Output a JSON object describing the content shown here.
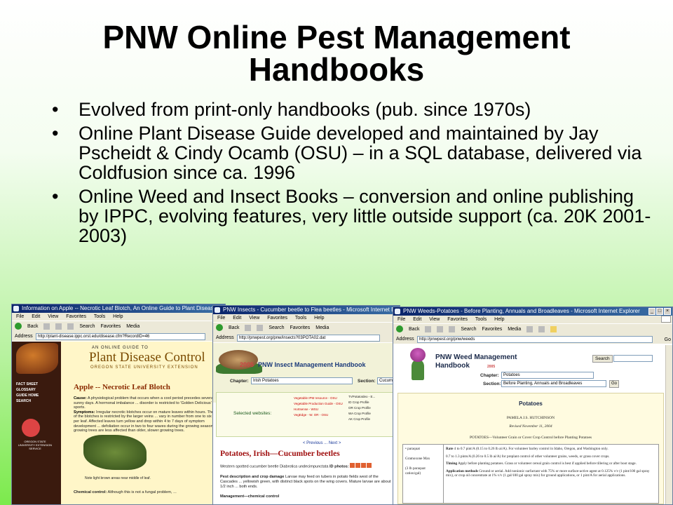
{
  "slide": {
    "title": "PNW Online Pest Management Handbooks",
    "bullets": [
      "Evolved from print-only handbooks (pub. since 1970s)",
      "Online Plant Disease Guide developed and maintained by Jay Pscheidt & Cindy Ocamb (OSU) – in a SQL database, delivered via Coldfusion since ca. 1996",
      "Online Weed and Insect Books – conversion and online publishing by IPPC, evolving features, very little outside support (ca. 20K 2001-2003)"
    ],
    "bullet_glyph": "•"
  },
  "browser": {
    "menu": [
      "File",
      "Edit",
      "View",
      "Favorites",
      "Tools",
      "Help"
    ],
    "back": "Back",
    "search": "Search",
    "favorites": "Favorites",
    "media": "Media",
    "address_label": "Address",
    "go": "Go"
  },
  "window1": {
    "title": "Information on Apple -- Necrotic Leaf Blotch, An Online Guide to Plant Disease Control",
    "url": "http://plant-disease.ippc.orst.edu/disease.cfm?RecordID=46",
    "guide_line": "AN ONLINE GUIDE TO",
    "brand": "Plant Disease Control",
    "osu_line": "OREGON STATE UNIVERSITY EXTENSION",
    "nav": [
      "FACT SHEET",
      "GLOSSARY",
      "GUIDE HOME",
      "SEARCH"
    ],
    "logo_text": "OREGON STATE UNIVERSITY EXTENSION SERVICE",
    "heading": "Apple -- Necrotic Leaf Blotch",
    "cause_label": "Cause:",
    "cause_text": "A physiological problem that occurs when a cool period precedes several hot, sunny days. A hormonal imbalance ... disorder is restricted to 'Golden Delicious' and its sports.",
    "symptoms_label": "Symptoms:",
    "symptoms_text": "Irregular necrotic blotches occur on mature leaves within hours. The shape of the blotches is restricted by the larger veins ... vary in number from one to six or more per leaf. Affected leaves turn yellow and drop within 4 to 7 days of symptom development ... defoliation occur in two to four waves during the growing season ... growing trees are less affected than older, slower growing trees.",
    "caption": "Note light brown areas near middle of leaf.",
    "chem_label": "Chemical control:",
    "chem_text": "Although this is not a fungal problem, ..."
  },
  "window2": {
    "title": "PNW Insects - Cucumber beetle to Flea beetles - Microsoft Internet Explorer",
    "url": "http://pnwpest.org/pnw/insects?03POTA02.dat",
    "year": "2005",
    "handbook": "PNW Insect Management Handbook",
    "chapter_label": "Chapter:",
    "chapter_value": "Irish Potatoes",
    "section_label": "Section:",
    "section_value": "Cucumber",
    "sites_label": "Selected websites:",
    "links_col1": [
      "Vegetable IPM resource - OSU",
      "Vegetable Production Guide - OSU",
      "Hortsense - WSU",
      "VegEdge - W. OR - OSU"
    ],
    "links_col2": [
      "TVPotatoIdeo - E...",
      "ID Crop Profile",
      "OR Crop Profile",
      "WA Crop Profile",
      "AK Crop Profile"
    ],
    "prevnext": "< Previous  ...  Next >",
    "pest_title": "Potatoes, Irish—Cucumber beetles",
    "species_text": "Western spotted cucumber beetle Diabrotica undecimpunctata",
    "photos_label": "ID photos:",
    "damage_label": "Pest description and crop damage",
    "damage_text": "Larvae may feed on tubers in potato fields west of the Cascades ... yellowish green, with distinct black spots on the wing covers. Mature larvae are about 1/2 inch ... both ends.",
    "mgmt_label": "Management—chemical control"
  },
  "window3": {
    "title": "PNW Weeds-Potatoes - Before Planting, Annuals and Broadleaves - Microsoft Internet Explorer",
    "url": "http://pnwpest.org/pnw/weeds",
    "handbook_line1": "PNW Weed Management",
    "handbook_line2": "Handbook",
    "year": "2005",
    "search_button": "Search",
    "chapter_label": "Chapter:",
    "chapter_value": "Potatoes",
    "section_label": "Section:",
    "section_value": "Before Planting, Annuals and Broadleaves",
    "go_button": "Go",
    "panel_title": "Potatoes",
    "author": "PAMELA J.S. HUTCHINSON",
    "revised": "Revised November 11, 2004",
    "subhead": "POTATOES—Volunteer Grain or Cover Crop Control before Planting Potatoes",
    "left_col": [
      "• paraquat",
      "Gramoxone Max",
      "(3 lb paraquat cation/gal)"
    ],
    "rate_label": "Rate",
    "rate_text": "4 to 0.7 pint/A (0.15 to 0.26 lb ai/A). For volunteer barley control in Idaho, Oregon, and Washington only.",
    "rate_text2": "0.7 to 1.3 pints/A (0.26 to 0.5 lb ai/A) for preplant control of other volunteer grains, weeds, or grass cover crops.",
    "timing_label": "Timing",
    "timing_text": "Apply before planting potatoes. Grass or volunteer cereal grain control is best if applied before tillering or after boot stage.",
    "app_label": "Application methods",
    "app_text": "Ground or aerial. Add nonionic surfactant with 75% or more surface-active agent at 0.125% v/v (1 pint/100 gal spray mix), or crop oil concentrate at 1% v/v (1 gal/100 gal spray mix) for ground applications, or 1 pint/A for aerial applications."
  }
}
